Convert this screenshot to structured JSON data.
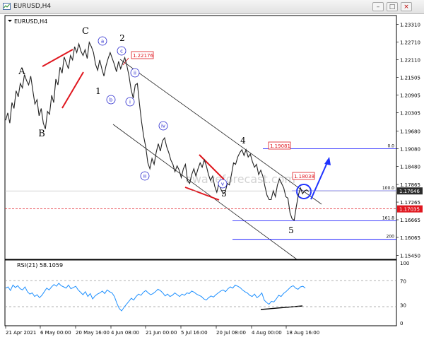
{
  "window": {
    "title": "EURUSD,H4",
    "buttons": {
      "minimize": "–",
      "restore": "□",
      "close": "×"
    }
  },
  "chart_header": "EURUSD,H4",
  "colors": {
    "price": "#232323",
    "rsi": "#1e90ff",
    "wave_label": "#2222cc",
    "highlight": "#e0171f",
    "fib_line": "#0000ff",
    "channel": "#262626",
    "price_tag_dark": "#2b2b2b",
    "price_tag_red": "#e0171f"
  },
  "chart_data": [
    {
      "type": "line",
      "symbol": "EURUSD",
      "timeframe": "H4",
      "x_ticks": [
        "21 Apr 2021",
        "6 May 00:00",
        "20 May 16:00",
        "4 Jun 08:00",
        "21 Jun 00:00",
        "5 Jul 16:00",
        "20 Jul 08:00",
        "4 Aug 00:00",
        "18 Aug 16:00"
      ],
      "y_ticks": [
        "1.23310",
        "1.22710",
        "1.22110",
        "1.21505",
        "1.20905",
        "1.20305",
        "1.19680",
        "1.19080",
        "1.18480",
        "1.17865",
        "1.17265",
        "1.16665",
        "1.16065",
        "1.15450"
      ],
      "ylim": [
        1.1532,
        1.2361
      ],
      "price_tags": [
        {
          "label": "1.17646",
          "value": 1.17646
        },
        {
          "label": "1.17035",
          "value": 1.17035
        }
      ],
      "path": [
        [
          0,
          1.2005
        ],
        [
          3,
          1.203
        ],
        [
          6,
          1.1995
        ],
        [
          9,
          1.2065
        ],
        [
          12,
          1.2045
        ],
        [
          15,
          1.2105
        ],
        [
          18,
          1.2085
        ],
        [
          21,
          1.213
        ],
        [
          24,
          1.2115
        ],
        [
          27,
          1.216
        ],
        [
          30,
          1.214
        ],
        [
          33,
          1.2125
        ],
        [
          36,
          1.2155
        ],
        [
          39,
          1.2105
        ],
        [
          42,
          1.206
        ],
        [
          45,
          1.2075
        ],
        [
          48,
          1.202
        ],
        [
          51,
          1.2045
        ],
        [
          54,
          1.1995
        ],
        [
          57,
          1.1975
        ],
        [
          60,
          1.2035
        ],
        [
          63,
          1.2025
        ],
        [
          66,
          1.209
        ],
        [
          69,
          1.2065
        ],
        [
          72,
          1.2145
        ],
        [
          75,
          1.2125
        ],
        [
          78,
          1.2185
        ],
        [
          81,
          1.2165
        ],
        [
          84,
          1.222
        ],
        [
          87,
          1.22
        ],
        [
          90,
          1.218
        ],
        [
          93,
          1.2225
        ],
        [
          96,
          1.221
        ],
        [
          99,
          1.2255
        ],
        [
          102,
          1.2235
        ],
        [
          105,
          1.2265
        ],
        [
          108,
          1.224
        ],
        [
          111,
          1.2225
        ],
        [
          114,
          1.2245
        ],
        [
          117,
          1.2215
        ],
        [
          120,
          1.227
        ],
        [
          123,
          1.2255
        ],
        [
          126,
          1.2235
        ],
        [
          129,
          1.2195
        ],
        [
          132,
          1.2175
        ],
        [
          135,
          1.221
        ],
        [
          138,
          1.218
        ],
        [
          141,
          1.2155
        ],
        [
          144,
          1.219
        ],
        [
          147,
          1.2215
        ],
        [
          150,
          1.2235
        ],
        [
          153,
          1.2215
        ],
        [
          156,
          1.2195
        ],
        [
          159,
          1.217
        ],
        [
          162,
          1.2205
        ],
        [
          165,
          1.218
        ],
        [
          168,
          1.22
        ],
        [
          171,
          1.2218
        ],
        [
          174,
          1.219
        ],
        [
          177,
          1.2155
        ],
        [
          180,
          1.211
        ],
        [
          183,
          1.208
        ],
        [
          186,
          1.2125
        ],
        [
          189,
          1.213
        ],
        [
          192,
          1.206
        ],
        [
          195,
          1.2
        ],
        [
          198,
          1.195
        ],
        [
          201,
          1.1915
        ],
        [
          204,
          1.186
        ],
        [
          207,
          1.184
        ],
        [
          210,
          1.1875
        ],
        [
          213,
          1.1855
        ],
        [
          216,
          1.1895
        ],
        [
          219,
          1.1925
        ],
        [
          222,
          1.19
        ],
        [
          225,
          1.1935
        ],
        [
          228,
          1.1945
        ],
        [
          231,
          1.1915
        ],
        [
          234,
          1.1895
        ],
        [
          237,
          1.187
        ],
        [
          240,
          1.1855
        ],
        [
          243,
          1.183
        ],
        [
          246,
          1.185
        ],
        [
          249,
          1.1835
        ],
        [
          252,
          1.181
        ],
        [
          255,
          1.184
        ],
        [
          258,
          1.1855
        ],
        [
          261,
          1.18
        ],
        [
          264,
          1.179
        ],
        [
          267,
          1.182
        ],
        [
          270,
          1.184
        ],
        [
          273,
          1.1815
        ],
        [
          276,
          1.184
        ],
        [
          279,
          1.186
        ],
        [
          282,
          1.1845
        ],
        [
          285,
          1.187
        ],
        [
          288,
          1.185
        ],
        [
          291,
          1.182
        ],
        [
          294,
          1.18
        ],
        [
          297,
          1.1815
        ],
        [
          300,
          1.178
        ],
        [
          303,
          1.176
        ],
        [
          306,
          1.179
        ],
        [
          309,
          1.177
        ],
        [
          312,
          1.1755
        ],
        [
          315,
          1.176
        ],
        [
          318,
          1.179
        ],
        [
          321,
          1.1785
        ],
        [
          324,
          1.182
        ],
        [
          327,
          1.186
        ],
        [
          330,
          1.1855
        ],
        [
          333,
          1.188
        ],
        [
          336,
          1.1895
        ],
        [
          339,
          1.1905
        ],
        [
          342,
          1.1885
        ],
        [
          345,
          1.1905
        ],
        [
          348,
          1.188
        ],
        [
          351,
          1.189
        ],
        [
          354,
          1.1865
        ],
        [
          357,
          1.1845
        ],
        [
          360,
          1.1855
        ],
        [
          363,
          1.182
        ],
        [
          366,
          1.1835
        ],
        [
          369,
          1.1815
        ],
        [
          372,
          1.178
        ],
        [
          375,
          1.175
        ],
        [
          378,
          1.1735
        ],
        [
          381,
          1.1735
        ],
        [
          384,
          1.1765
        ],
        [
          387,
          1.1745
        ],
        [
          390,
          1.1785
        ],
        [
          393,
          1.1805
        ],
        [
          396,
          1.179
        ],
        [
          399,
          1.1775
        ],
        [
          402,
          1.1745
        ],
        [
          405,
          1.174
        ],
        [
          408,
          1.169
        ],
        [
          411,
          1.167
        ],
        [
          414,
          1.1665
        ],
        [
          417,
          1.171
        ],
        [
          420,
          1.175
        ],
        [
          423,
          1.1775
        ],
        [
          426,
          1.1755
        ],
        [
          429,
          1.1765
        ],
        [
          432,
          1.1768
        ],
        [
          435,
          1.1763
        ]
      ],
      "wave_labels": [
        "A",
        "B",
        "C",
        "1",
        "2",
        "3",
        "4",
        "5"
      ],
      "sub_wave_labels": [
        "a",
        "b",
        "c",
        "i",
        "ii",
        "iii",
        "iv",
        "v"
      ],
      "fib_levels": [
        {
          "label": "0.0",
          "value": 1.1908
        },
        {
          "label": "100.0",
          "value": 1.17646
        },
        {
          "label": "161.8",
          "value": 1.1663
        },
        {
          "label": "200",
          "value": 1.16
        }
      ],
      "annotations": [
        {
          "label": "1.22176",
          "value": 1.22176
        },
        {
          "label": "1.19081",
          "value": 1.19081
        },
        {
          "label": "1.18038",
          "value": 1.18038
        }
      ],
      "watermark": "ewaveforecast.com"
    },
    {
      "type": "line",
      "title": "RSI(21) 58.1059",
      "y_ticks": [
        "100",
        "70",
        "30",
        "0"
      ],
      "ylim": [
        0,
        100
      ],
      "values": [
        58,
        60,
        54,
        63,
        59,
        62,
        57,
        55,
        60,
        52,
        48,
        50,
        44,
        47,
        42,
        46,
        52,
        58,
        55,
        60,
        64,
        61,
        66,
        62,
        60,
        58,
        63,
        57,
        59,
        61,
        55,
        51,
        47,
        52,
        44,
        49,
        40,
        45,
        48,
        50,
        53,
        49,
        55,
        52,
        50,
        44,
        33,
        24,
        20,
        26,
        31,
        36,
        41,
        38,
        44,
        48,
        46,
        51,
        54,
        50,
        47,
        49,
        52,
        56,
        54,
        50,
        45,
        48,
        44,
        46,
        50,
        47,
        44,
        48,
        46,
        50,
        49,
        53,
        51,
        48,
        46,
        44,
        40,
        38,
        42,
        45,
        43,
        47,
        50,
        53,
        55,
        52,
        57,
        60,
        58,
        63,
        61,
        59,
        55,
        52,
        50,
        46,
        44,
        48,
        42,
        45,
        50,
        38,
        34,
        31,
        36,
        35,
        40,
        46,
        44,
        49,
        52,
        56,
        60,
        62,
        58,
        56,
        60,
        61,
        58
      ]
    }
  ]
}
